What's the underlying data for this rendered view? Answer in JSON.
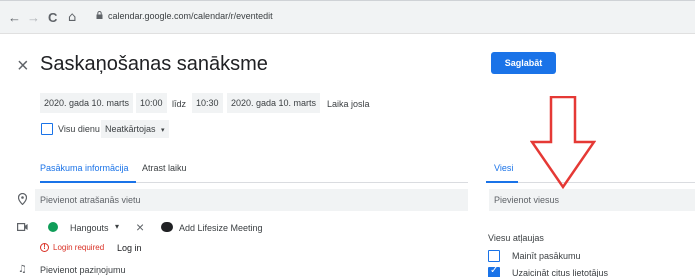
{
  "browser": {
    "back": "←",
    "forward": "→",
    "reload": "C",
    "home": "⌂",
    "url": "calendar.google.com/calendar/r/eventedit"
  },
  "event": {
    "close": "×",
    "title": "Saskaņošanas sanāksme",
    "save_label": "Saglabāt"
  },
  "datetime": {
    "start_date": "2020. gada 10. marts",
    "start_time": "10:00",
    "until": "līdz",
    "end_time": "10:30",
    "end_date": "2020. gada 10. marts",
    "timezone": "Laika josla"
  },
  "allday": {
    "label": "Visu dienu",
    "checked": false,
    "repeat": "Neatkārtojas"
  },
  "tabs": [
    {
      "label": "Pasākuma informācija",
      "active": true
    },
    {
      "label": "Atrast laiku",
      "active": false
    }
  ],
  "details": {
    "location_placeholder": "Pievienot atrašanās vietu",
    "conference": "Hangouts",
    "lifesize": "Add Lifesize Meeting",
    "login_required": "Login required",
    "login": "Log in",
    "notification": "Pievienot paziņojumu"
  },
  "guests": {
    "tab": "Viesi",
    "add_placeholder": "Pievienot viesus",
    "permissions_title": "Viesu atļaujas",
    "permissions": [
      {
        "label": "Mainīt pasākumu",
        "checked": false
      },
      {
        "label": "Uzaicināt citus lietotājus",
        "checked": true
      }
    ]
  },
  "colors": {
    "accent": "#1a73e8",
    "annotation_arrow": "#e53935"
  }
}
